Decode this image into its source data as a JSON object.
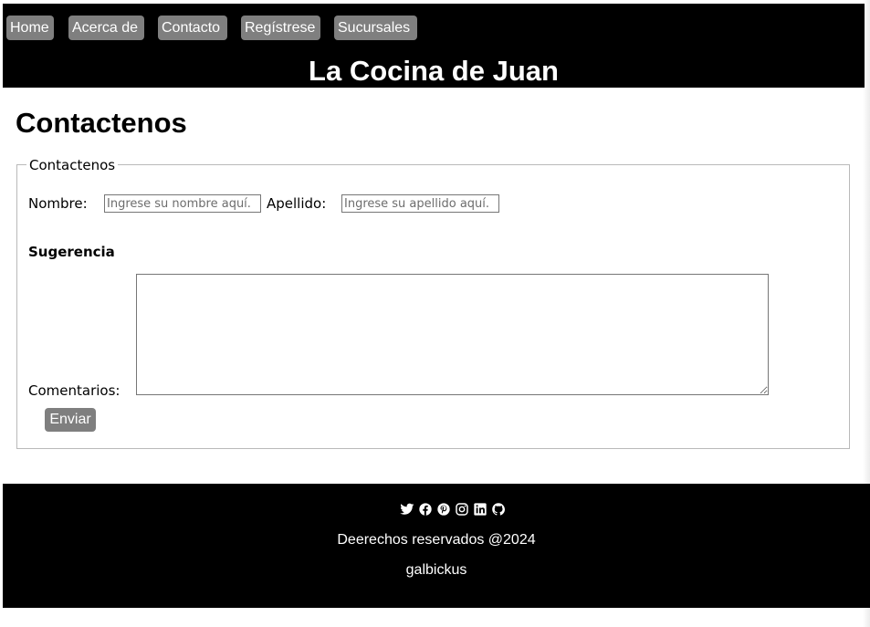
{
  "nav": {
    "items": [
      {
        "label": "Home"
      },
      {
        "label": "Acerca de"
      },
      {
        "label": "Contacto"
      },
      {
        "label": "Regístrese"
      },
      {
        "label": "Sucursales"
      }
    ]
  },
  "header": {
    "site_title": "La Cocina de Juan"
  },
  "page": {
    "title": "Contactenos"
  },
  "form": {
    "legend": "Contactenos",
    "nombre_label": "Nombre:",
    "nombre_placeholder": "Ingrese su nombre aquí.",
    "apellido_label": "Apellido:",
    "apellido_placeholder": "Ingrese su apellido aquí.",
    "section_heading": "Sugerencia",
    "comentarios_label": "Comentarios:",
    "comentarios_value": "",
    "submit_label": "Enviar"
  },
  "footer": {
    "social_icons": [
      "twitter-icon",
      "facebook-icon",
      "pinterest-icon",
      "instagram-icon",
      "linkedin-icon",
      "github-icon"
    ],
    "copyright": "Deerechos reservados @2024",
    "author": "galbickus"
  },
  "colors": {
    "header_bg": "#000000",
    "nav_button_bg": "#7f7f7f",
    "footer_bg": "#000000",
    "text_on_dark": "#ffffff"
  }
}
